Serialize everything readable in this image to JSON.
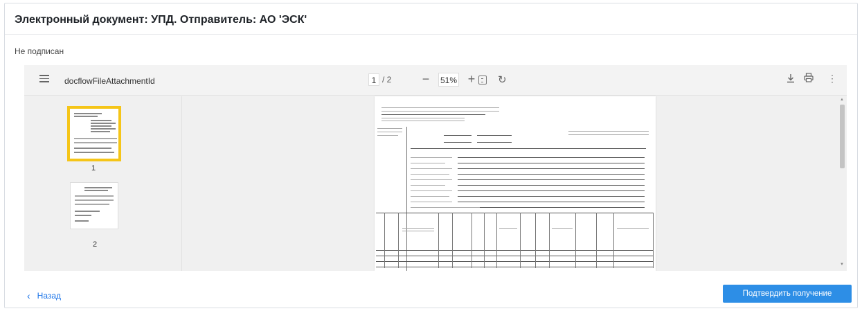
{
  "header": {
    "title": "Электронный документ: УПД. Отправитель: АО 'ЭСК'"
  },
  "status_text": "Не подписан",
  "viewer": {
    "filename": "docflowFileAttachmentId",
    "current_page": "1",
    "page_separator": "/ 2",
    "zoom": "51%",
    "zoom_out_label": "−",
    "zoom_in_label": "+",
    "thumbnails": [
      {
        "label": "1"
      },
      {
        "label": "2"
      }
    ],
    "icons": {
      "menu": "menu-icon",
      "fit": "fit-page-icon",
      "rotate": "rotate-icon",
      "download": "download-icon",
      "print": "print-icon",
      "more": "more-vertical-icon"
    }
  },
  "footer": {
    "back_label": "Назад",
    "confirm_label": "Подтвердить получение"
  },
  "colors": {
    "accent": "#2d8ee6",
    "link": "#1a73e8",
    "thumb_highlight": "#f5c518"
  }
}
